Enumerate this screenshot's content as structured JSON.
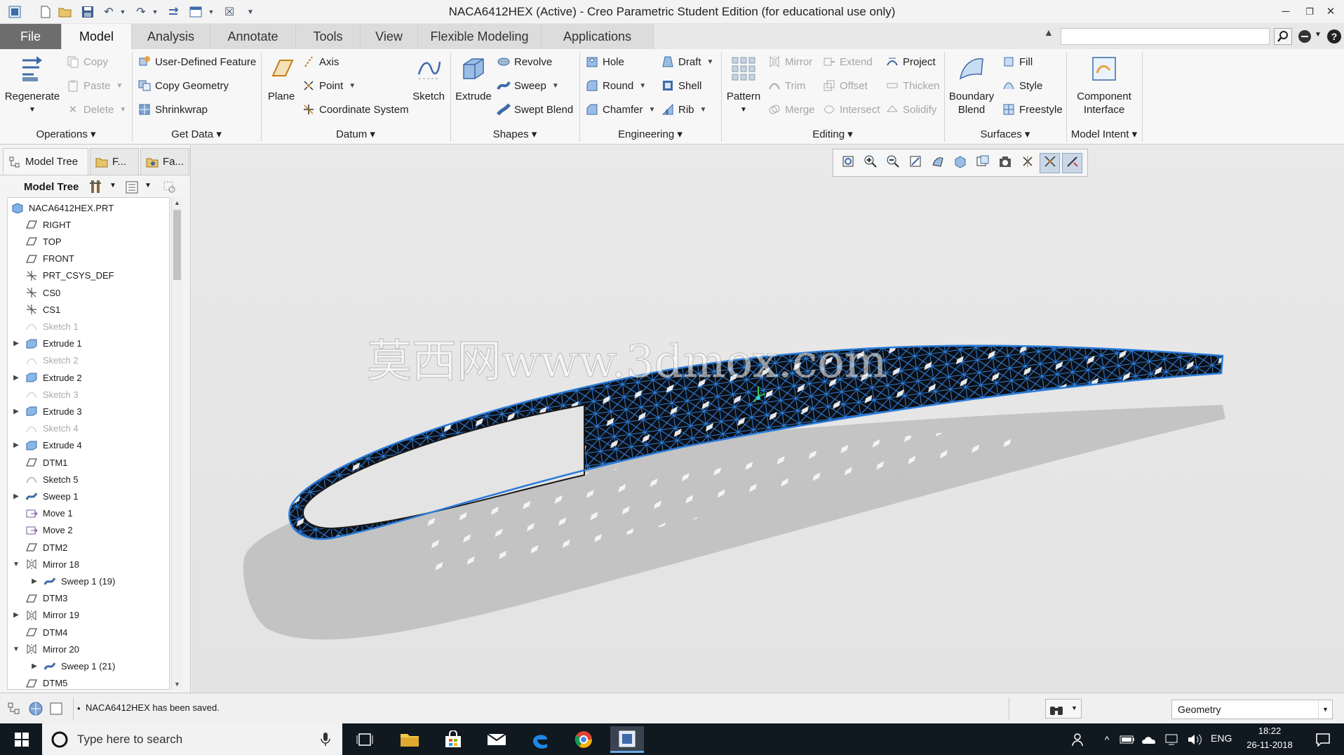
{
  "window": {
    "title": "NACA6412HEX (Active) - Creo Parametric Student Edition (for educational use only)",
    "minimize_icon": "window-minimize-icon",
    "restore_icon": "window-restore-icon",
    "close_icon": "window-close-icon"
  },
  "quick_access": {
    "icons": [
      "app-icon",
      "new-icon",
      "open-icon",
      "save-icon",
      "undo-icon",
      "redo-icon",
      "regenerate-icon",
      "window-icon",
      "close-window-icon",
      "customize-icon"
    ]
  },
  "tabs": {
    "file": "File",
    "model": "Model",
    "analysis": "Analysis",
    "annotate": "Annotate",
    "tools": "Tools",
    "view": "View",
    "flexible": "Flexible Modeling",
    "applications": "Applications"
  },
  "search": {
    "placeholder": ""
  },
  "ribbon": {
    "operations": {
      "regenerate": "Regenerate",
      "copy": "Copy",
      "paste": "Paste",
      "delete": "Delete",
      "group": "Operations"
    },
    "get_data": {
      "udf": "User-Defined Feature",
      "copy_geometry": "Copy Geometry",
      "shrinkwrap": "Shrinkwrap",
      "group": "Get Data"
    },
    "datum": {
      "plane": "Plane",
      "axis": "Axis",
      "point": "Point",
      "csys": "Coordinate System",
      "sketch": "Sketch",
      "group": "Datum"
    },
    "shapes": {
      "extrude": "Extrude",
      "revolve": "Revolve",
      "sweep": "Sweep",
      "swept_blend": "Swept Blend",
      "group": "Shapes"
    },
    "engineering": {
      "hole": "Hole",
      "round": "Round",
      "chamfer": "Chamfer",
      "draft": "Draft",
      "shell": "Shell",
      "rib": "Rib",
      "group": "Engineering"
    },
    "editing": {
      "pattern": "Pattern",
      "mirror": "Mirror",
      "trim": "Trim",
      "merge": "Merge",
      "extend": "Extend",
      "offset": "Offset",
      "intersect": "Intersect",
      "project": "Project",
      "thicken": "Thicken",
      "solidify": "Solidify",
      "group": "Editing"
    },
    "surfaces": {
      "boundary_blend_1": "Boundary",
      "boundary_blend_2": "Blend",
      "fill": "Fill",
      "style": "Style",
      "freestyle": "Freestyle",
      "group": "Surfaces"
    },
    "model_intent": {
      "component_1": "Component",
      "component_2": "Interface",
      "group": "Model Intent"
    }
  },
  "left_panel": {
    "tab_model_tree": "Model Tree",
    "tab_folder": "F...",
    "tab_favorites": "Fa...",
    "header": "Model Tree",
    "tree": [
      {
        "label": "NACA6412HEX.PRT",
        "icon": "part-icon",
        "indent": 0,
        "exp": "",
        "dim": false
      },
      {
        "label": "RIGHT",
        "icon": "datum-plane-icon",
        "indent": 1,
        "exp": "",
        "dim": false
      },
      {
        "label": "TOP",
        "icon": "datum-plane-icon",
        "indent": 1,
        "exp": "",
        "dim": false
      },
      {
        "label": "FRONT",
        "icon": "datum-plane-icon",
        "indent": 1,
        "exp": "",
        "dim": false
      },
      {
        "label": "PRT_CSYS_DEF",
        "icon": "csys-icon",
        "indent": 1,
        "exp": "",
        "dim": false
      },
      {
        "label": "CS0",
        "icon": "csys-icon",
        "indent": 1,
        "exp": "",
        "dim": false
      },
      {
        "label": "CS1",
        "icon": "csys-icon",
        "indent": 1,
        "exp": "",
        "dim": false
      },
      {
        "label": "Sketch 1",
        "icon": "sketch-icon",
        "indent": 1,
        "exp": "",
        "dim": true
      },
      {
        "label": "Extrude 1",
        "icon": "extrude-icon",
        "indent": 1,
        "exp": "▶",
        "dim": false
      },
      {
        "label": "Sketch 2",
        "icon": "sketch-icon",
        "indent": 1,
        "exp": "",
        "dim": true
      },
      {
        "label": "Extrude 2",
        "icon": "extrude-icon",
        "indent": 1,
        "exp": "▶",
        "dim": false
      },
      {
        "label": "Sketch 3",
        "icon": "sketch-icon",
        "indent": 1,
        "exp": "",
        "dim": true
      },
      {
        "label": "Extrude 3",
        "icon": "extrude-icon",
        "indent": 1,
        "exp": "▶",
        "dim": false
      },
      {
        "label": "Sketch 4",
        "icon": "sketch-icon",
        "indent": 1,
        "exp": "",
        "dim": true
      },
      {
        "label": "Extrude 4",
        "icon": "extrude-icon",
        "indent": 1,
        "exp": "▶",
        "dim": false
      },
      {
        "label": "DTM1",
        "icon": "datum-plane-icon",
        "indent": 1,
        "exp": "",
        "dim": false
      },
      {
        "label": "Sketch 5",
        "icon": "sketch-icon",
        "indent": 1,
        "exp": "",
        "dim": false
      },
      {
        "label": "Sweep 1",
        "icon": "sweep-icon",
        "indent": 1,
        "exp": "▶",
        "dim": false
      },
      {
        "label": "Move 1",
        "icon": "move-icon",
        "indent": 1,
        "exp": "",
        "dim": false
      },
      {
        "label": "Move 2",
        "icon": "move-icon",
        "indent": 1,
        "exp": "",
        "dim": false
      },
      {
        "label": "DTM2",
        "icon": "datum-plane-icon",
        "indent": 1,
        "exp": "",
        "dim": false
      },
      {
        "label": "Mirror 18",
        "icon": "mirror-icon",
        "indent": 1,
        "exp": "▼",
        "dim": false
      },
      {
        "label": "Sweep 1 (19)",
        "icon": "sweep-icon",
        "indent": 2,
        "exp": "▶",
        "dim": false
      },
      {
        "label": "DTM3",
        "icon": "datum-plane-icon",
        "indent": 1,
        "exp": "",
        "dim": false
      },
      {
        "label": "Mirror 19",
        "icon": "mirror-icon",
        "indent": 1,
        "exp": "▶",
        "dim": false
      },
      {
        "label": "DTM4",
        "icon": "datum-plane-icon",
        "indent": 1,
        "exp": "",
        "dim": false
      },
      {
        "label": "Mirror 20",
        "icon": "mirror-icon",
        "indent": 1,
        "exp": "▼",
        "dim": false
      },
      {
        "label": "Sweep 1 (21)",
        "icon": "sweep-icon",
        "indent": 2,
        "exp": "▶",
        "dim": false
      },
      {
        "label": "DTM5",
        "icon": "datum-plane-icon",
        "indent": 1,
        "exp": "",
        "dim": false
      }
    ]
  },
  "viewport": {
    "watermark": "莫西网www.3dmox.com",
    "toolbar_icons": [
      "refit-icon",
      "zoom-in-icon",
      "zoom-out-icon",
      "repaint-icon",
      "display-style-icon",
      "saved-orientations-icon",
      "view-manager-icon",
      "perspective-icon",
      "datum-display-icon",
      "spin-center-icon",
      "annotation-display-icon"
    ]
  },
  "status": {
    "message": "NACA6412HEX has been saved.",
    "filter": "Geometry"
  },
  "taskbar": {
    "search_placeholder": "Type here to search",
    "lang": "ENG",
    "time": "18:22",
    "date": "26-11-2018"
  }
}
